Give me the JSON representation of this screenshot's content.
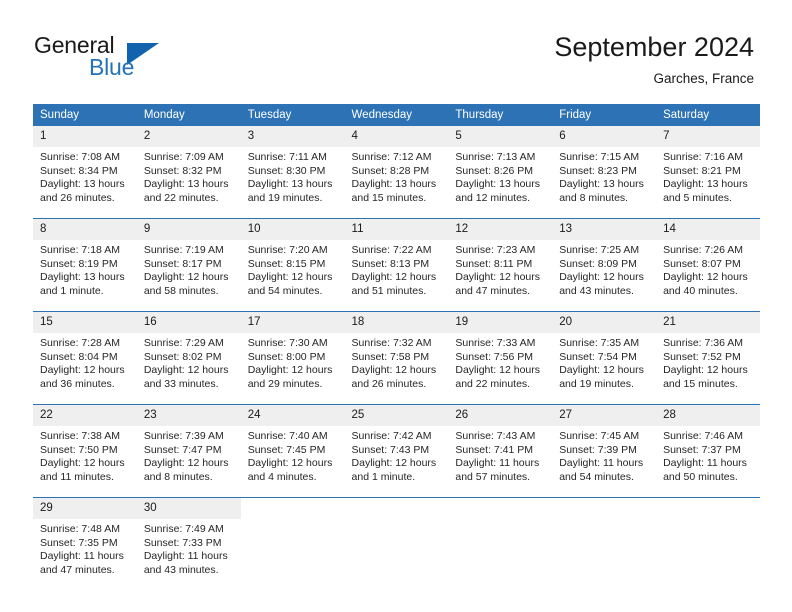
{
  "brand": {
    "name_part1": "General",
    "name_part2": "Blue",
    "logo_icon": "triangle-logo"
  },
  "header": {
    "title": "September 2024",
    "subtitle": "Garches, France"
  },
  "calendar": {
    "weekday_headers": [
      "Sunday",
      "Monday",
      "Tuesday",
      "Wednesday",
      "Thursday",
      "Friday",
      "Saturday"
    ],
    "colors": {
      "header_blue": "#2d72b5",
      "daynum_gray": "#efefef",
      "brand_blue": "#2572b8",
      "logo_blue": "#1263ad"
    },
    "weeks": [
      [
        {
          "day": "1",
          "sunrise": "Sunrise: 7:08 AM",
          "sunset": "Sunset: 8:34 PM",
          "daylight_line1": "Daylight: 13 hours",
          "daylight_line2": "and 26 minutes."
        },
        {
          "day": "2",
          "sunrise": "Sunrise: 7:09 AM",
          "sunset": "Sunset: 8:32 PM",
          "daylight_line1": "Daylight: 13 hours",
          "daylight_line2": "and 22 minutes."
        },
        {
          "day": "3",
          "sunrise": "Sunrise: 7:11 AM",
          "sunset": "Sunset: 8:30 PM",
          "daylight_line1": "Daylight: 13 hours",
          "daylight_line2": "and 19 minutes."
        },
        {
          "day": "4",
          "sunrise": "Sunrise: 7:12 AM",
          "sunset": "Sunset: 8:28 PM",
          "daylight_line1": "Daylight: 13 hours",
          "daylight_line2": "and 15 minutes."
        },
        {
          "day": "5",
          "sunrise": "Sunrise: 7:13 AM",
          "sunset": "Sunset: 8:26 PM",
          "daylight_line1": "Daylight: 13 hours",
          "daylight_line2": "and 12 minutes."
        },
        {
          "day": "6",
          "sunrise": "Sunrise: 7:15 AM",
          "sunset": "Sunset: 8:23 PM",
          "daylight_line1": "Daylight: 13 hours",
          "daylight_line2": "and 8 minutes."
        },
        {
          "day": "7",
          "sunrise": "Sunrise: 7:16 AM",
          "sunset": "Sunset: 8:21 PM",
          "daylight_line1": "Daylight: 13 hours",
          "daylight_line2": "and 5 minutes."
        }
      ],
      [
        {
          "day": "8",
          "sunrise": "Sunrise: 7:18 AM",
          "sunset": "Sunset: 8:19 PM",
          "daylight_line1": "Daylight: 13 hours",
          "daylight_line2": "and 1 minute."
        },
        {
          "day": "9",
          "sunrise": "Sunrise: 7:19 AM",
          "sunset": "Sunset: 8:17 PM",
          "daylight_line1": "Daylight: 12 hours",
          "daylight_line2": "and 58 minutes."
        },
        {
          "day": "10",
          "sunrise": "Sunrise: 7:20 AM",
          "sunset": "Sunset: 8:15 PM",
          "daylight_line1": "Daylight: 12 hours",
          "daylight_line2": "and 54 minutes."
        },
        {
          "day": "11",
          "sunrise": "Sunrise: 7:22 AM",
          "sunset": "Sunset: 8:13 PM",
          "daylight_line1": "Daylight: 12 hours",
          "daylight_line2": "and 51 minutes."
        },
        {
          "day": "12",
          "sunrise": "Sunrise: 7:23 AM",
          "sunset": "Sunset: 8:11 PM",
          "daylight_line1": "Daylight: 12 hours",
          "daylight_line2": "and 47 minutes."
        },
        {
          "day": "13",
          "sunrise": "Sunrise: 7:25 AM",
          "sunset": "Sunset: 8:09 PM",
          "daylight_line1": "Daylight: 12 hours",
          "daylight_line2": "and 43 minutes."
        },
        {
          "day": "14",
          "sunrise": "Sunrise: 7:26 AM",
          "sunset": "Sunset: 8:07 PM",
          "daylight_line1": "Daylight: 12 hours",
          "daylight_line2": "and 40 minutes."
        }
      ],
      [
        {
          "day": "15",
          "sunrise": "Sunrise: 7:28 AM",
          "sunset": "Sunset: 8:04 PM",
          "daylight_line1": "Daylight: 12 hours",
          "daylight_line2": "and 36 minutes."
        },
        {
          "day": "16",
          "sunrise": "Sunrise: 7:29 AM",
          "sunset": "Sunset: 8:02 PM",
          "daylight_line1": "Daylight: 12 hours",
          "daylight_line2": "and 33 minutes."
        },
        {
          "day": "17",
          "sunrise": "Sunrise: 7:30 AM",
          "sunset": "Sunset: 8:00 PM",
          "daylight_line1": "Daylight: 12 hours",
          "daylight_line2": "and 29 minutes."
        },
        {
          "day": "18",
          "sunrise": "Sunrise: 7:32 AM",
          "sunset": "Sunset: 7:58 PM",
          "daylight_line1": "Daylight: 12 hours",
          "daylight_line2": "and 26 minutes."
        },
        {
          "day": "19",
          "sunrise": "Sunrise: 7:33 AM",
          "sunset": "Sunset: 7:56 PM",
          "daylight_line1": "Daylight: 12 hours",
          "daylight_line2": "and 22 minutes."
        },
        {
          "day": "20",
          "sunrise": "Sunrise: 7:35 AM",
          "sunset": "Sunset: 7:54 PM",
          "daylight_line1": "Daylight: 12 hours",
          "daylight_line2": "and 19 minutes."
        },
        {
          "day": "21",
          "sunrise": "Sunrise: 7:36 AM",
          "sunset": "Sunset: 7:52 PM",
          "daylight_line1": "Daylight: 12 hours",
          "daylight_line2": "and 15 minutes."
        }
      ],
      [
        {
          "day": "22",
          "sunrise": "Sunrise: 7:38 AM",
          "sunset": "Sunset: 7:50 PM",
          "daylight_line1": "Daylight: 12 hours",
          "daylight_line2": "and 11 minutes."
        },
        {
          "day": "23",
          "sunrise": "Sunrise: 7:39 AM",
          "sunset": "Sunset: 7:47 PM",
          "daylight_line1": "Daylight: 12 hours",
          "daylight_line2": "and 8 minutes."
        },
        {
          "day": "24",
          "sunrise": "Sunrise: 7:40 AM",
          "sunset": "Sunset: 7:45 PM",
          "daylight_line1": "Daylight: 12 hours",
          "daylight_line2": "and 4 minutes."
        },
        {
          "day": "25",
          "sunrise": "Sunrise: 7:42 AM",
          "sunset": "Sunset: 7:43 PM",
          "daylight_line1": "Daylight: 12 hours",
          "daylight_line2": "and 1 minute."
        },
        {
          "day": "26",
          "sunrise": "Sunrise: 7:43 AM",
          "sunset": "Sunset: 7:41 PM",
          "daylight_line1": "Daylight: 11 hours",
          "daylight_line2": "and 57 minutes."
        },
        {
          "day": "27",
          "sunrise": "Sunrise: 7:45 AM",
          "sunset": "Sunset: 7:39 PM",
          "daylight_line1": "Daylight: 11 hours",
          "daylight_line2": "and 54 minutes."
        },
        {
          "day": "28",
          "sunrise": "Sunrise: 7:46 AM",
          "sunset": "Sunset: 7:37 PM",
          "daylight_line1": "Daylight: 11 hours",
          "daylight_line2": "and 50 minutes."
        }
      ],
      [
        {
          "day": "29",
          "sunrise": "Sunrise: 7:48 AM",
          "sunset": "Sunset: 7:35 PM",
          "daylight_line1": "Daylight: 11 hours",
          "daylight_line2": "and 47 minutes."
        },
        {
          "day": "30",
          "sunrise": "Sunrise: 7:49 AM",
          "sunset": "Sunset: 7:33 PM",
          "daylight_line1": "Daylight: 11 hours",
          "daylight_line2": "and 43 minutes."
        },
        {
          "day": "",
          "sunrise": "",
          "sunset": "",
          "daylight_line1": "",
          "daylight_line2": ""
        },
        {
          "day": "",
          "sunrise": "",
          "sunset": "",
          "daylight_line1": "",
          "daylight_line2": ""
        },
        {
          "day": "",
          "sunrise": "",
          "sunset": "",
          "daylight_line1": "",
          "daylight_line2": ""
        },
        {
          "day": "",
          "sunrise": "",
          "sunset": "",
          "daylight_line1": "",
          "daylight_line2": ""
        },
        {
          "day": "",
          "sunrise": "",
          "sunset": "",
          "daylight_line1": "",
          "daylight_line2": ""
        }
      ]
    ]
  }
}
